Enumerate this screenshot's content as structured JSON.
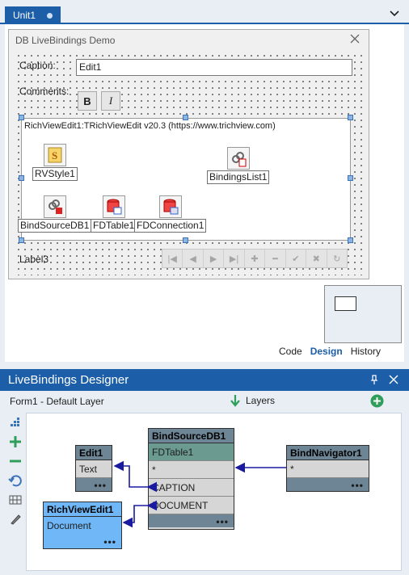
{
  "tab": {
    "label": "Unit1"
  },
  "form": {
    "title": "DB LiveBindings Demo",
    "caption_label": "Caption:",
    "caption_value": "Edit1",
    "comments_label": "Comments:",
    "bold_label": "B",
    "italic_label": "I",
    "rve_text": "RichViewEdit1:TRichViewEdit v20.3 (https://www.trichview.com)",
    "components": {
      "rvstyle": "RVStyle1",
      "bindingslist": "BindingsList1",
      "bindsource": "BindSourceDB1",
      "fdtable": "FDTable1",
      "fdconnection": "FDConnection1"
    },
    "label3": "Label3"
  },
  "view_tabs": {
    "code": "Code",
    "design": "Design",
    "history": "History"
  },
  "designer": {
    "title": "LiveBindings Designer",
    "layer_info": "Form1  - Default Layer",
    "layers_label": "Layers",
    "nodes": {
      "edit1": {
        "title": "Edit1",
        "row1": "Text",
        "dots": "•••"
      },
      "richviewedit1": {
        "title": "RichViewEdit1",
        "row1": "Document",
        "dots": "•••"
      },
      "bindsourcedb1": {
        "title": "BindSourceDB1",
        "subtitle": "FDTable1",
        "row_star": "*",
        "row_caption": "CAPTION",
        "row_document": "DOCUMENT",
        "dots": "•••"
      },
      "bindnavigator1": {
        "title": "BindNavigator1",
        "row_star": "*",
        "dots": "•••"
      }
    }
  },
  "colors": {
    "accent": "#1c5ea7",
    "node_header": "#6d8595",
    "node_blue": "#6fb7f7",
    "link": "#1a1aa0",
    "add_green": "#2e9e5a"
  }
}
